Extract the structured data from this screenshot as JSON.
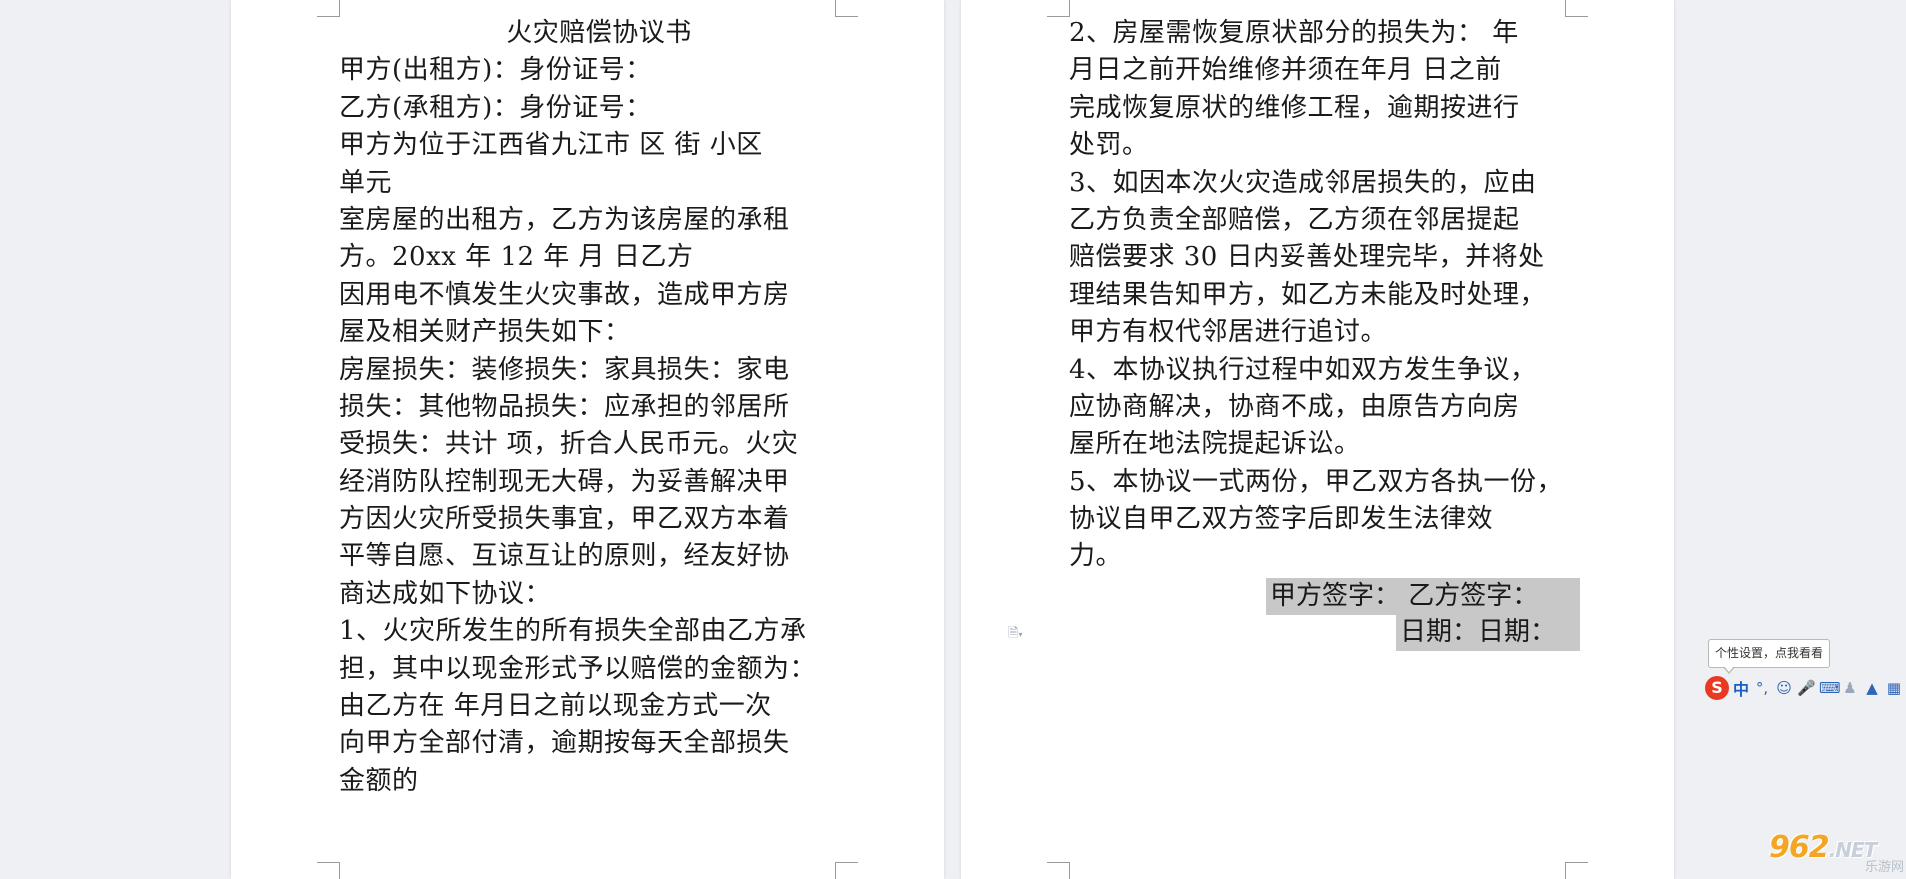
{
  "left_page": {
    "title": "火灾赔偿协议书",
    "lines": [
      "甲方(出租方)：身份证号：",
      "乙方(承租方)：身份证号：",
      "甲方为位于江西省九江市 区 街 小区",
      "单元",
      "室房屋的出租方，乙方为该房屋的承租",
      "方。20xx 年 12 年 月 日乙方",
      "因用电不慎发生火灾事故，造成甲方房",
      "屋及相关财产损失如下：",
      "房屋损失：装修损失：家具损失：家电",
      "损失：其他物品损失：应承担的邻居所",
      "受损失：共计 项，折合人民币元。火灾",
      "经消防队控制现无大碍，为妥善解决甲",
      "方因火灾所受损失事宜，甲乙双方本着",
      "平等自愿、互谅互让的原则，经友好协",
      "商达成如下协议：",
      "1、火灾所发生的所有损失全部由乙方承",
      "担，其中以现金形式予以赔偿的金额为：",
      "由乙方在 年月日之前以现金方式一次",
      "向甲方全部付清，逾期按每天全部损失",
      "金额的"
    ]
  },
  "right_page": {
    "lines": [
      "2、房屋需恢复原状部分的损失为： 年",
      "月日之前开始维修并须在年月 日之前",
      "完成恢复原状的维修工程，逾期按进行",
      "处罚。",
      "3、如因本次火灾造成邻居损失的，应由",
      "乙方负责全部赔偿，乙方须在邻居提起",
      "赔偿要求 30 日内妥善处理完毕，并将处",
      "理结果告知甲方，如乙方未能及时处理，",
      "甲方有权代邻居进行追讨。",
      "4、本协议执行过程中如双方发生争议，",
      "应协商解决，协商不成，由原告方向房",
      "屋所在地法院提起诉讼。",
      "5、本协议一式两份，甲乙双方各执一份，",
      "协议自甲乙双方签字后即发生法律效",
      "力。"
    ],
    "signature_line": "甲方签字：  乙方签字：",
    "date_line": "日期：日期："
  },
  "ime": {
    "tooltip": "个性设置，点我看看",
    "logo": "S",
    "mode": "中",
    "icons": [
      "punctuation-icon",
      "emoji-icon",
      "microphone-icon",
      "keyboard-icon",
      "user-icon",
      "skin-icon",
      "grid-icon"
    ]
  },
  "watermark": {
    "brand": "962",
    "suffix": ".NET",
    "subtitle": "乐游网"
  }
}
